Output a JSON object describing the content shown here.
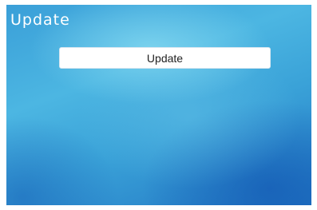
{
  "screen": {
    "title": "Update"
  },
  "actions": {
    "update_label": "Update"
  },
  "colors": {
    "background_light": "#4cb6e2",
    "background_dark": "#2277c4",
    "title_text": "#ffffff",
    "button_background": "#ffffff",
    "button_text": "#222222"
  }
}
